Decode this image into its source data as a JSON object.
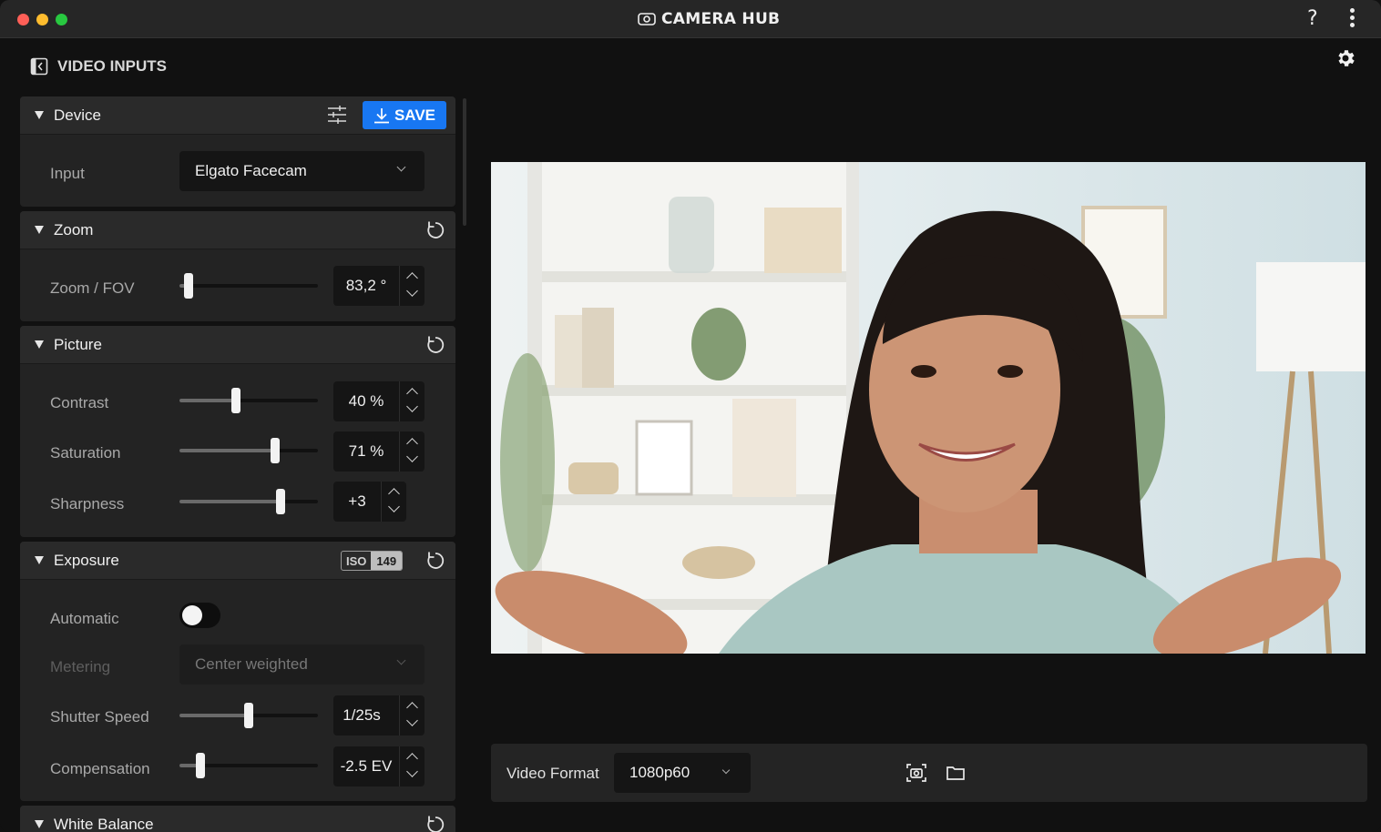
{
  "window": {
    "app_title": "CAMERA HUB",
    "help_label": "?",
    "icons": [
      "camera-icon",
      "help-icon",
      "more-vertical-icon",
      "settings-gear-icon"
    ]
  },
  "sidebar": {
    "title": "VIDEO INPUTS",
    "device": {
      "title": "Device",
      "save_label": "SAVE",
      "input_label": "Input",
      "input_value": "Elgato Facecam"
    },
    "zoom": {
      "title": "Zoom",
      "fov_label": "Zoom / FOV",
      "fov_value": "83,2 °",
      "fov_level": 0.03
    },
    "picture": {
      "title": "Picture",
      "contrast_label": "Contrast",
      "contrast_value": "40 %",
      "contrast_level": 0.4,
      "saturation_label": "Saturation",
      "saturation_value": "71 %",
      "saturation_level": 0.71,
      "sharpness_label": "Sharpness",
      "sharpness_value": "+3",
      "sharpness_level": 0.75
    },
    "exposure": {
      "title": "Exposure",
      "iso_label": "ISO",
      "iso_value": "149",
      "automatic_label": "Automatic",
      "automatic_on": false,
      "metering_label": "Metering",
      "metering_value": "Center weighted",
      "shutter_label": "Shutter Speed",
      "shutter_value": "1/25s",
      "shutter_level": 0.5,
      "compensation_label": "Compensation",
      "compensation_value": "-2.5 EV",
      "compensation_level": 0.12
    },
    "white_balance": {
      "title": "White Balance"
    }
  },
  "preview": {
    "video_format_label": "Video Format",
    "video_format_value": "1080p60"
  }
}
